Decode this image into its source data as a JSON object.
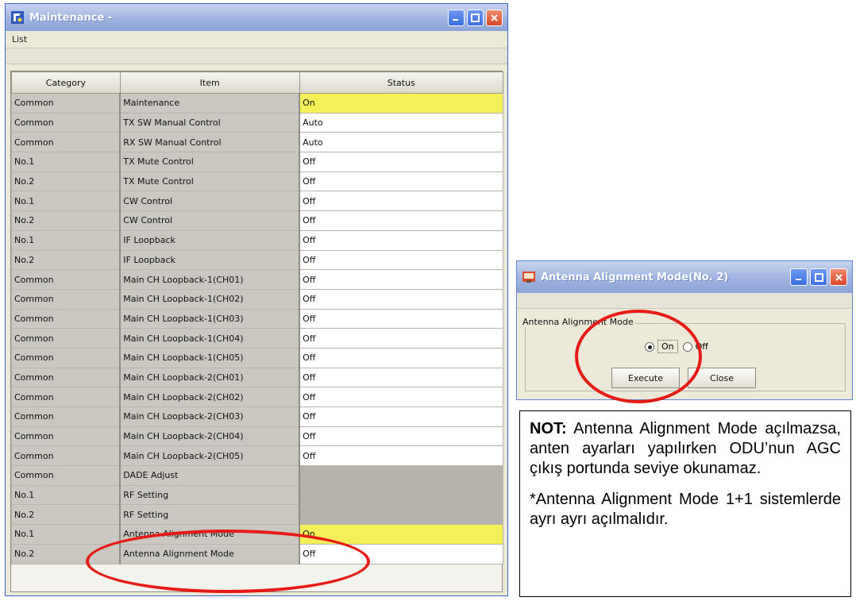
{
  "maintenance_window": {
    "title": "Maintenance",
    "title_suffix": " -",
    "menu": [
      "List"
    ],
    "columns": [
      "Category",
      "Item",
      "Status"
    ],
    "rows": [
      {
        "category": "Common",
        "item": "Maintenance",
        "status": "On",
        "highlight": true
      },
      {
        "category": "Common",
        "item": "TX SW Manual Control",
        "status": "Auto"
      },
      {
        "category": "Common",
        "item": "RX SW Manual Control",
        "status": "Auto"
      },
      {
        "category": "No.1",
        "item": "TX Mute Control",
        "status": "Off"
      },
      {
        "category": "No.2",
        "item": "TX Mute Control",
        "status": "Off"
      },
      {
        "category": "No.1",
        "item": "CW Control",
        "status": "Off"
      },
      {
        "category": "No.2",
        "item": "CW Control",
        "status": "Off"
      },
      {
        "category": "No.1",
        "item": "IF Loopback",
        "status": "Off"
      },
      {
        "category": "No.2",
        "item": "IF Loopback",
        "status": "Off"
      },
      {
        "category": "Common",
        "item": "Main CH Loopback-1(CH01)",
        "status": "Off"
      },
      {
        "category": "Common",
        "item": "Main CH Loopback-1(CH02)",
        "status": "Off"
      },
      {
        "category": "Common",
        "item": "Main CH Loopback-1(CH03)",
        "status": "Off"
      },
      {
        "category": "Common",
        "item": "Main CH Loopback-1(CH04)",
        "status": "Off"
      },
      {
        "category": "Common",
        "item": "Main CH Loopback-1(CH05)",
        "status": "Off"
      },
      {
        "category": "Common",
        "item": "Main CH Loopback-2(CH01)",
        "status": "Off"
      },
      {
        "category": "Common",
        "item": "Main CH Loopback-2(CH02)",
        "status": "Off"
      },
      {
        "category": "Common",
        "item": "Main CH Loopback-2(CH03)",
        "status": "Off"
      },
      {
        "category": "Common",
        "item": "Main CH Loopback-2(CH04)",
        "status": "Off"
      },
      {
        "category": "Common",
        "item": "Main CH Loopback-2(CH05)",
        "status": "Off"
      },
      {
        "category": "Common",
        "item": "DADE Adjust",
        "status": "",
        "disabled": true
      },
      {
        "category": "No.1",
        "item": "RF Setting",
        "status": "",
        "disabled": true
      },
      {
        "category": "No.2",
        "item": "RF Setting",
        "status": "",
        "disabled": true
      },
      {
        "category": "No.1",
        "item": "Antenna Alignment Mode",
        "status": "On",
        "highlight": true
      },
      {
        "category": "No.2",
        "item": "Antenna Alignment Mode",
        "status": "Off"
      }
    ]
  },
  "antenna_dialog": {
    "title": "Antenna Alignment Mode(No. 2)",
    "group_label": "Antenna Alignment Mode",
    "radio_on": "On",
    "radio_off": "Off",
    "selected": "On",
    "execute_label": "Execute",
    "close_label": "Close"
  },
  "note": {
    "bold_prefix": "NOT:",
    "line1": " Antenna Alignment Mode açılmazsa, anten ayarları yapılırken ODU’nun AGC çıkış portunda seviye okunamaz.",
    "line2": "*Antenna Alignment Mode 1+1 sistemlerde ayrı ayrı açılmalıdır."
  },
  "colors": {
    "highlight": "#f5f05a",
    "annotation": "#e51b14",
    "titlebar": "#8ba4d8"
  }
}
